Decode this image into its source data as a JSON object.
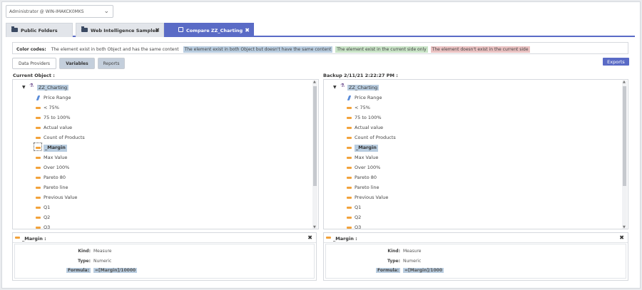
{
  "user_select": {
    "value": "Administrator @ WIN-IMAKCK0MKS"
  },
  "tabs": [
    {
      "label": "Public Folders",
      "closable": false
    },
    {
      "label": "Web Intelligence Samples",
      "closable": true
    },
    {
      "label": "Compare ZZ_Charting",
      "closable": true
    }
  ],
  "legend": {
    "title": "Color codes:",
    "same": "The element exist in both Object and has the same content",
    "diff": "The element exist in both Object but doesn't have the same content",
    "current_only": "The element exist in the current side only",
    "missing": "The element doesn't exist in the current side"
  },
  "sub_tabs": {
    "data_providers": "Data Providers",
    "variables": "Variables",
    "reports": "Reports"
  },
  "exports_label": "Exports",
  "left": {
    "title": "Current Object :",
    "root": "ZZ_Charting",
    "items": [
      "Price Range",
      "< 75%",
      "75 to 100%",
      "Actual value",
      "Count of Products",
      "_Margin",
      "Max Value",
      "Over 100%",
      "Pareto 80",
      "Pareto line",
      "Previous Value",
      "Q1",
      "Q2",
      "Q3"
    ],
    "detail": {
      "title": "_Margin :",
      "kind_label": "Kind:",
      "kind": "Measure",
      "type_label": "Type:",
      "type": "Numeric",
      "formula_label": "Formula:",
      "formula": "=[Margin]/10000"
    }
  },
  "right": {
    "title": "Backup 2/11/21 2:22:27 PM :",
    "root": "ZZ_Charting",
    "items": [
      "Price Range",
      "< 75%",
      "75 to 100%",
      "Actual value",
      "Count of Products",
      "_Margin",
      "Max Value",
      "Over 100%",
      "Pareto 80",
      "Pareto line",
      "Previous Value",
      "Q1",
      "Q2",
      "Q3"
    ],
    "detail": {
      "title": "_Margin :",
      "kind_label": "Kind:",
      "kind": "Measure",
      "type_label": "Type:",
      "type": "Numeric",
      "formula_label": "Formula:",
      "formula": "=[Margin]/1000"
    }
  },
  "colors": {
    "accent": "#5a6bc6",
    "diff": "#b9cde0",
    "current_only": "#c8e3c6",
    "missing": "#eac2c2",
    "measure_icon": "#f2a23a",
    "dimension_icon": "#5a8bd8"
  },
  "icons": {
    "tab": "folder-icon",
    "compare": "compare-icon",
    "close": "close-icon",
    "measure": "measure-icon",
    "dimension": "dimension-icon",
    "expand": "caret-down-icon",
    "root": "document-icon"
  }
}
